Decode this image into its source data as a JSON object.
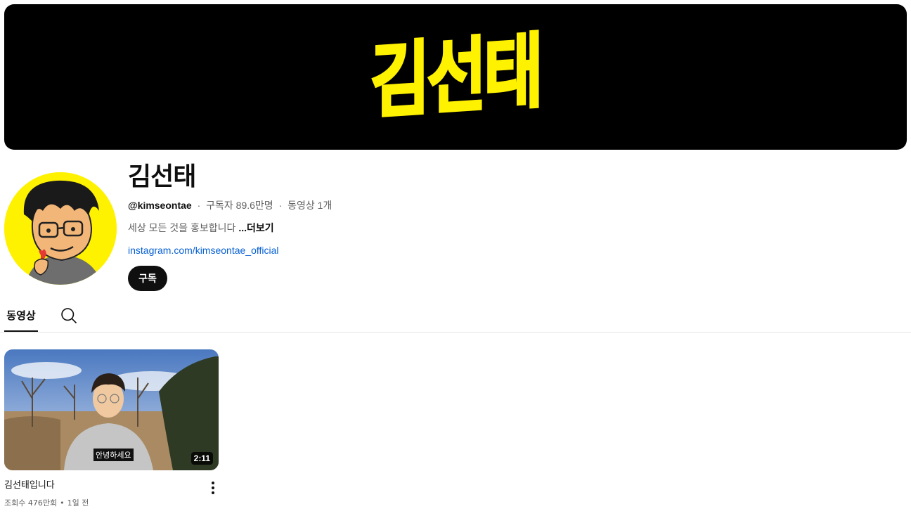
{
  "banner": {
    "text": "김선태",
    "text_color": "#fff200",
    "background": "#000000"
  },
  "channel": {
    "name": "김선태",
    "handle": "@kimseontae",
    "subscribers": "구독자 89.6만명",
    "video_count": "동영상 1개",
    "separator": "·",
    "description": "세상 모든 것을 홍보합니다",
    "more_label": "...더보기",
    "link": "instagram.com/kimseontae_official",
    "subscribe_label": "구독",
    "avatar_bg": "#fff200"
  },
  "tabs": {
    "videos_label": "동영상",
    "search_icon": "search-icon"
  },
  "videos": [
    {
      "title": "김선태입니다",
      "caption": "안녕하세요",
      "duration": "2:11",
      "views": "조회수 476만회",
      "age": "1일 전",
      "separator": "•"
    }
  ]
}
